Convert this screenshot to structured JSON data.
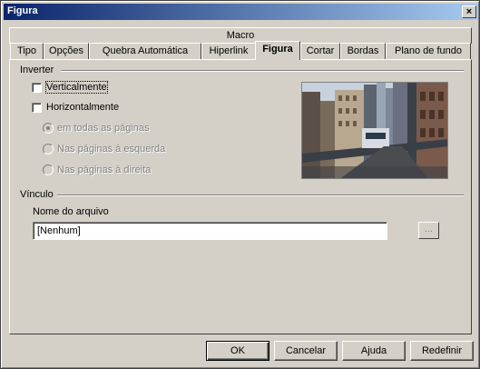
{
  "window": {
    "title": "Figura",
    "close_glyph": "×"
  },
  "tabs": {
    "row1": [
      {
        "label": "Macro"
      }
    ],
    "row2": [
      {
        "label": "Tipo"
      },
      {
        "label": "Opções"
      },
      {
        "label": "Quebra Automática"
      },
      {
        "label": "Hiperlink"
      },
      {
        "label": "Figura",
        "active": true
      },
      {
        "label": "Cortar"
      },
      {
        "label": "Bordas"
      },
      {
        "label": "Plano de fundo"
      }
    ]
  },
  "inverter": {
    "heading": "Inverter",
    "vertical": {
      "label": "Verticalmente",
      "checked": false
    },
    "horizontal": {
      "label": "Horizontalmente",
      "checked": false
    },
    "options": [
      {
        "label": "em todas as páginas",
        "selected": true
      },
      {
        "label": "Nas páginas à esquerda",
        "selected": false
      },
      {
        "label": "Nas páginas à direita",
        "selected": false
      }
    ]
  },
  "preview": {
    "icon": "image-preview"
  },
  "vinculo": {
    "heading": "Vínculo",
    "file_label": "Nome do arquivo",
    "file_value": "[Nenhum]",
    "browse_label": "..."
  },
  "buttons": {
    "ok": "OK",
    "cancel": "Cancelar",
    "help": "Ajuda",
    "reset": "Redefinir"
  },
  "colors": {
    "titlebar_start": "#0a246a",
    "titlebar_end": "#a6caf0",
    "face": "#d4d0c8"
  }
}
